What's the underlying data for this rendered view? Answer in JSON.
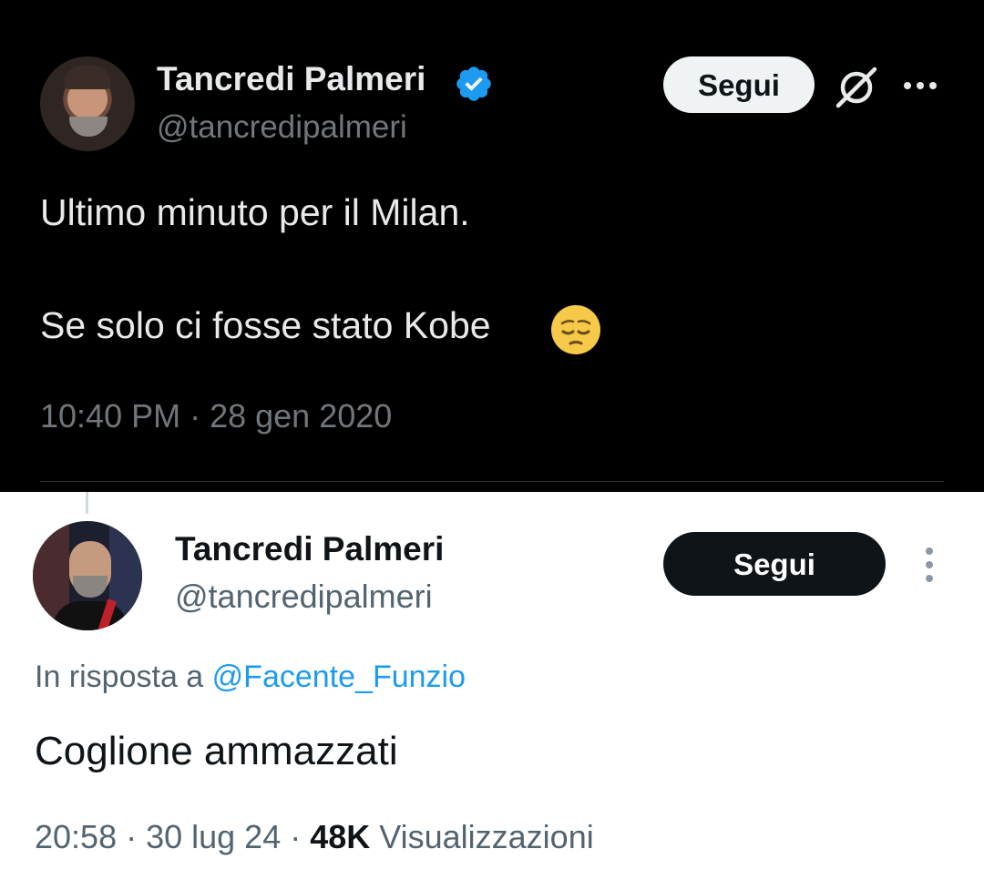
{
  "first_tweet": {
    "author_name": "Tancredi Palmeri",
    "handle": "@tancredipalmeri",
    "follow_label": "Segui",
    "verified_icon": "verified-badge-icon",
    "text_line_1": "Ultimo minuto per il Milan.",
    "text_line_2": "Se solo ci fosse stato Kobe",
    "emoji": "pensive-face-icon",
    "timestamp": "10:40 PM · 28 gen 2020",
    "colors": {
      "background": "#000000",
      "text": "#e7e9ea",
      "secondary": "#71767b",
      "verified": "#1d9bf0"
    }
  },
  "second_tweet": {
    "author_name": "Tancredi Palmeri",
    "handle": "@tancredipalmeri",
    "follow_label": "Segui",
    "reply_prefix": "In risposta a",
    "reply_to": "@Facente_Funzio",
    "text": "Coglione ammazzati",
    "time_date": "20:58 · 30 lug 24 · ",
    "views_count": "48K",
    "views_label": "Visualizzazioni",
    "colors": {
      "background": "#ffffff",
      "text": "#0f1419",
      "secondary": "#536471",
      "link": "#1d9bf0"
    }
  }
}
